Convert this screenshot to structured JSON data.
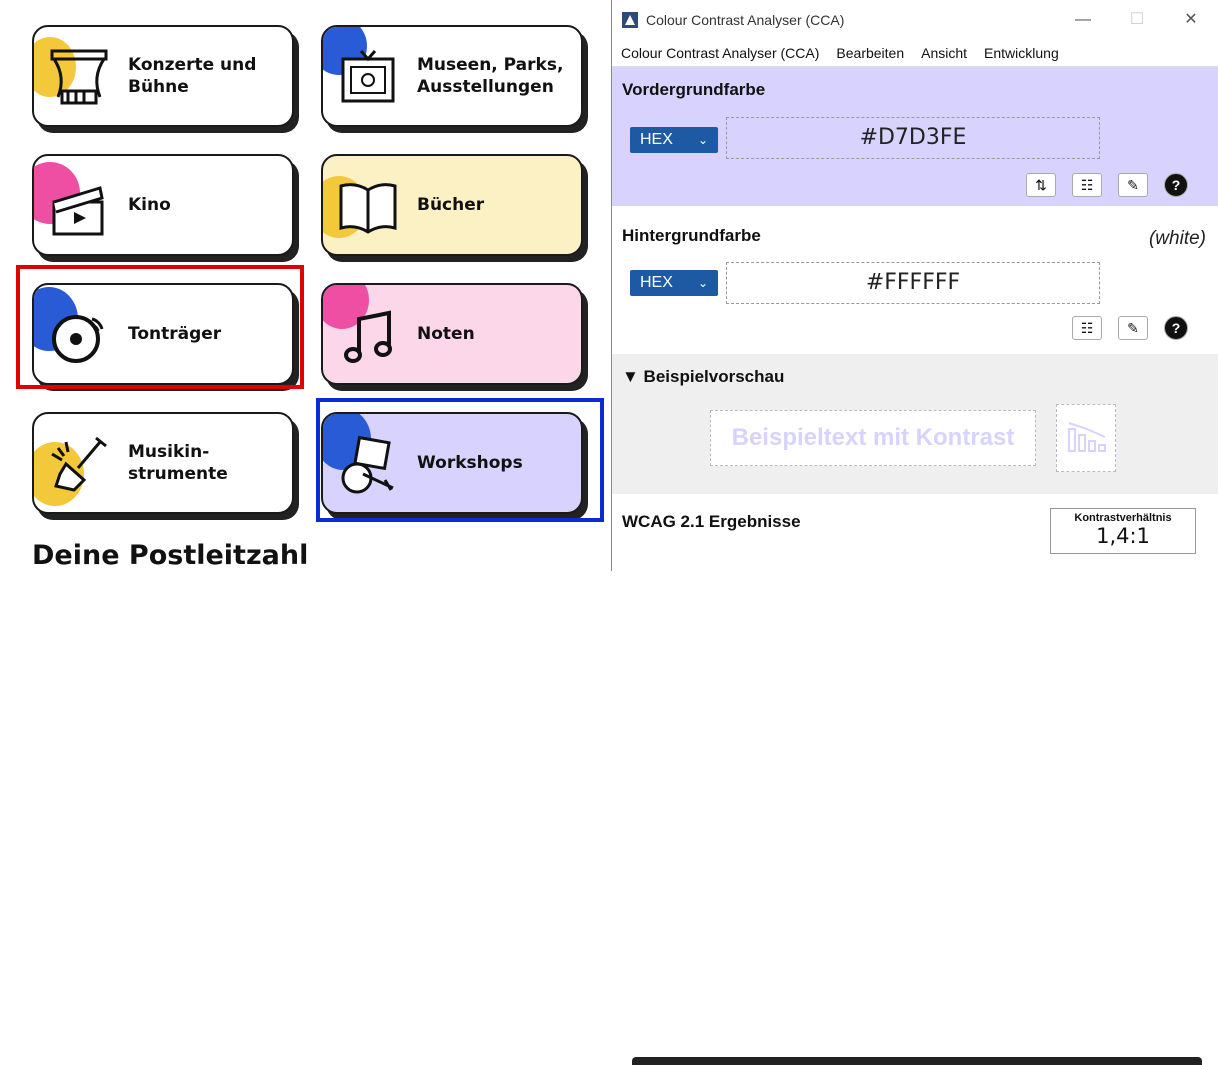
{
  "categories": [
    {
      "label_lines": [
        "Konzerte und",
        "Bühne"
      ],
      "icon": "theater-stage-icon",
      "bg": "#ffffff",
      "blob": "#f3c83a"
    },
    {
      "label_lines": [
        "Museen, Parks,",
        "Ausstellungen"
      ],
      "icon": "framed-picture-icon",
      "bg": "#ffffff",
      "blob": "#2a5bd7"
    },
    {
      "label_lines": [
        "Kino"
      ],
      "icon": "clapperboard-icon",
      "bg": "#ffffff",
      "blob": "#ee4fa3"
    },
    {
      "label_lines": [
        "Bücher"
      ],
      "icon": "open-book-icon",
      "bg": "#fcf0c5",
      "blob": "#f3c83a"
    },
    {
      "label_lines": [
        "Tonträger"
      ],
      "icon": "vinyl-record-icon",
      "bg": "#ffffff",
      "blob": "#2a5bd7"
    },
    {
      "label_lines": [
        "Noten"
      ],
      "icon": "music-note-icon",
      "bg": "#fcd7ea",
      "blob": "#ee4fa3"
    },
    {
      "label_lines": [
        "Musikin-",
        "strumente"
      ],
      "icon": "electric-guitar-icon",
      "bg": "#ffffff",
      "blob": "#f3c83a"
    },
    {
      "label_lines": [
        "Workshops"
      ],
      "icon": "workshop-easel-icon",
      "bg": "#d7d3fe",
      "blob": "#2a5bd7"
    }
  ],
  "page_heading": "Deine Postleitzahl",
  "cca": {
    "window_title": "Colour Contrast Analyser (CCA)",
    "window_buttons": {
      "minimize": "—",
      "maximize": "☐",
      "close": "✕"
    },
    "menu": [
      "Colour Contrast Analyser (CCA)",
      "Bearbeiten",
      "Ansicht",
      "Entwicklung"
    ],
    "foreground": {
      "title": "Vordergrundfarbe",
      "format": "HEX",
      "value": "#D7D3FE",
      "color": "#d7d3fe"
    },
    "background": {
      "title": "Hintergrundfarbe",
      "note": "(white)",
      "format": "HEX",
      "value": "#FFFFFF",
      "color": "#ffffff"
    },
    "tools": {
      "swap": "⇅",
      "sliders": "☷",
      "picker": "✎",
      "help": "?"
    },
    "preview": {
      "title": "▼ Beispielvorschau",
      "sample_text": "Beispieltext mit Kontrast"
    },
    "results": {
      "title": "WCAG 2.1 Ergebnisse",
      "ratio_label": "Kontrastverhältnis",
      "ratio_value": "1,4:1"
    }
  }
}
